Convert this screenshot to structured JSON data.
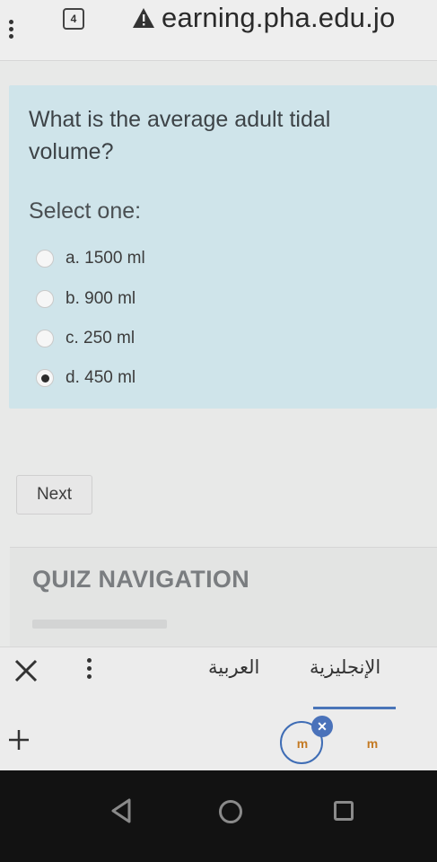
{
  "browser": {
    "tab_count": "4",
    "url": "earning.pha.edu.jo"
  },
  "quiz": {
    "question": "What is the average adult tidal volume?",
    "select_label": "Select one:",
    "options": [
      {
        "label": "a. 1500 ml",
        "selected": false
      },
      {
        "label": "b. 900 ml",
        "selected": false
      },
      {
        "label": "c. 250 ml",
        "selected": false
      },
      {
        "label": "d. 450 ml",
        "selected": true
      }
    ],
    "next_label": "Next",
    "nav_title": "QUIZ NAVIGATION"
  },
  "keyboard": {
    "lang_arabic": "العربية",
    "lang_english": "الإنجليزية",
    "app_icon_glyph": "m"
  }
}
